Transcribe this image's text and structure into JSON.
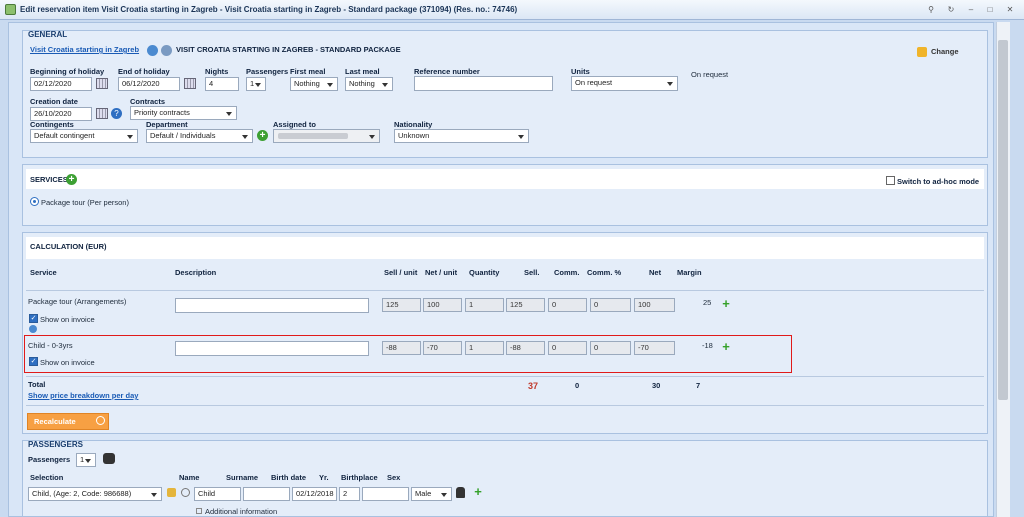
{
  "window": {
    "title": "Edit reservation item Visit Croatia starting in Zagreb - Visit Croatia starting in Zagreb - Standard package (371094) (Res. no.: 74746)"
  },
  "general": {
    "header": "GENERAL",
    "tour_link": "Visit Croatia starting in Zagreb",
    "tour_title": "VISIT CROATIA STARTING IN ZAGREB - STANDARD PACKAGE",
    "change_label": "Change",
    "on_request_text": "On request",
    "fields": {
      "beginning_label": "Beginning of holiday",
      "beginning_value": "02/12/2020",
      "end_label": "End of holiday",
      "end_value": "06/12/2020",
      "nights_label": "Nights",
      "nights_value": "4",
      "passengers_label": "Passengers",
      "passengers_value": "1",
      "first_meal_label": "First meal",
      "first_meal_value": "Nothing",
      "last_meal_label": "Last meal",
      "last_meal_value": "Nothing",
      "reference_label": "Reference number",
      "reference_value": "",
      "units_label": "Units",
      "units_value": "On request",
      "creation_label": "Creation date",
      "creation_value": "26/10/2020",
      "contracts_label": "Contracts",
      "contracts_value": "Priority contracts",
      "contingents_label": "Contingents",
      "contingents_value": "Default contingent",
      "department_label": "Department",
      "department_value": "Default / Individuals",
      "assigned_label": "Assigned to",
      "assigned_value": "",
      "nationality_label": "Nationality",
      "nationality_value": "Unknown"
    }
  },
  "services": {
    "header": "SERVICES",
    "adhoc_label": "Switch to ad-hoc mode",
    "option_label": "Package tour (Per person)"
  },
  "calculation": {
    "header": "CALCULATION (EUR)",
    "columns": {
      "service": "Service",
      "description": "Description",
      "sell_unit": "Sell / unit",
      "net_unit": "Net / unit",
      "quantity": "Quantity",
      "sell": "Sell.",
      "comm": "Comm.",
      "comm_pct": "Comm. %",
      "net": "Net",
      "margin": "Margin"
    },
    "rows": [
      {
        "service": "Package tour (Arrangements)",
        "show_on_invoice": "Show on invoice",
        "description": "",
        "sell_unit": "125",
        "net_unit": "100",
        "quantity": "1",
        "sell": "125",
        "comm": "0",
        "comm_pct": "0",
        "net": "100",
        "margin": "25"
      },
      {
        "service": "Child - 0-3yrs",
        "show_on_invoice": "Show on invoice",
        "description": "",
        "sell_unit": "-88",
        "net_unit": "-70",
        "quantity": "1",
        "sell": "-88",
        "comm": "0",
        "comm_pct": "0",
        "net": "-70",
        "margin": "-18"
      }
    ],
    "total": {
      "label": "Total",
      "breakdown_link": "Show price breakdown per day",
      "sell": "37",
      "comm": "0",
      "net": "30",
      "margin": "7"
    },
    "recalculate_label": "Recalculate"
  },
  "passengers": {
    "header": "PASSENGERS",
    "count_label": "Passengers",
    "count_value": "1",
    "columns": {
      "selection": "Selection",
      "name": "Name",
      "surname": "Surname",
      "birth_date": "Birth date",
      "yr": "Yr.",
      "birthplace": "Birthplace",
      "sex": "Sex"
    },
    "row": {
      "selection": "Child, (Age: 2, Code: 986688)",
      "name": "Child",
      "surname": "",
      "birth_date": "02/12/2018",
      "yr": "2",
      "birthplace": "",
      "sex": "Male"
    },
    "additional_info": "Additional information"
  }
}
